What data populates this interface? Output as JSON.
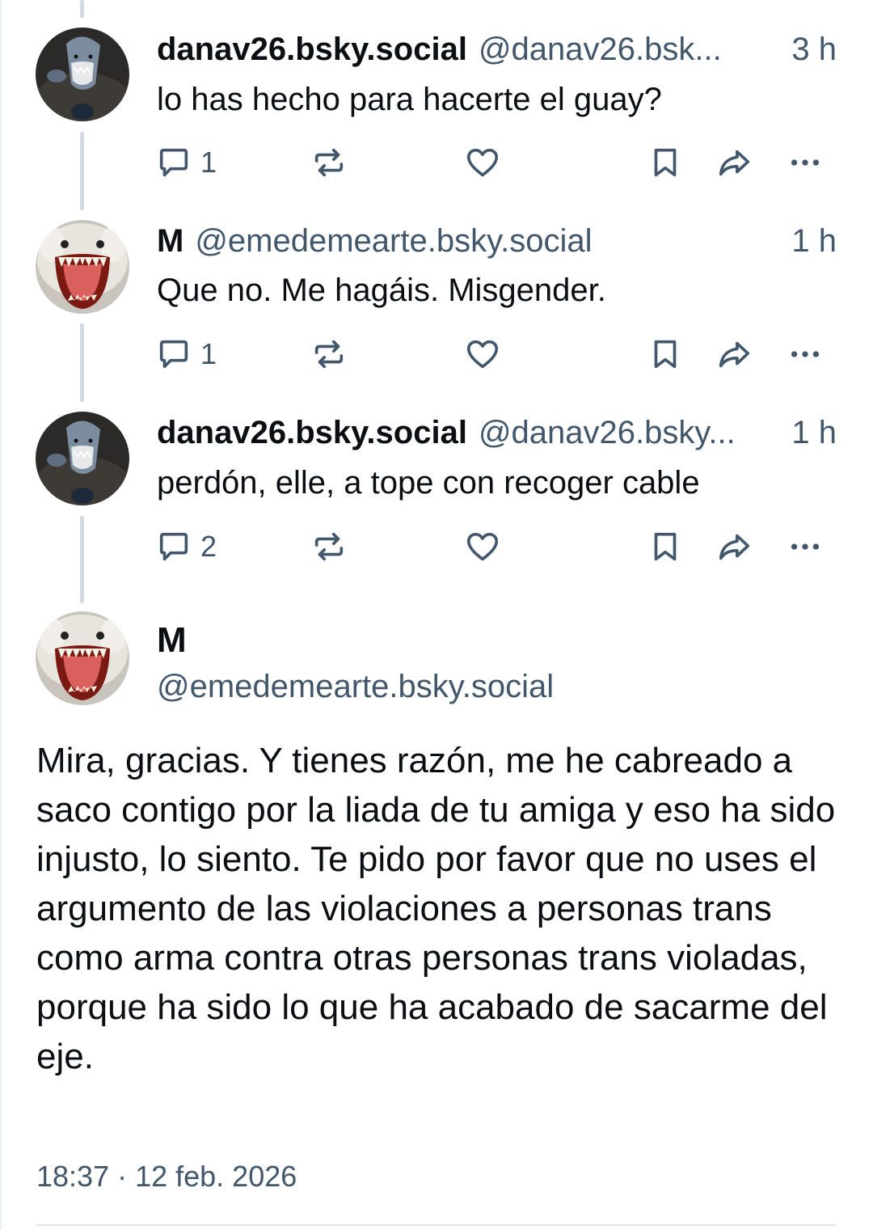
{
  "replies": [
    {
      "display_name": "danav26.bsky.social",
      "handle": "@danav26.bsk...",
      "time": "3 h",
      "text": "lo has hecho para hacerte el guay?",
      "reply_count": "1",
      "avatar": "shark-plush-avatar"
    },
    {
      "display_name": "M",
      "handle": "@emedemearte.bsky.social",
      "time": "1 h",
      "text": "Que no. Me hagáis. Misgender.",
      "reply_count": "1",
      "avatar": "screaming-animal-avatar"
    },
    {
      "display_name": "danav26.bsky.social",
      "handle": "@danav26.bsky...",
      "time": "1 h",
      "text": "perdón, elle, a tope con recoger cable",
      "reply_count": "2",
      "avatar": "shark-plush-avatar"
    }
  ],
  "main_post": {
    "display_name": "M",
    "handle": "@emedemearte.bsky.social",
    "text": "Mira, gracias. Y tienes razón, me he cabreado a saco contigo por la liada de tu amiga y eso ha sido injusto, lo siento. Te pido por favor que no uses el argumento de las violaciones a personas trans como arma contra otras personas trans violadas, porque ha sido lo que ha acabado de sacarme del eje.",
    "timestamp": "18:37 · 12 feb. 2026",
    "avatar": "screaming-animal-avatar"
  },
  "icons": {
    "reply": "speech-bubble-icon",
    "repost": "repost-arrows-icon",
    "like": "heart-icon",
    "bookmark": "bookmark-icon",
    "share": "share-arrow-icon",
    "more": "more-dots-icon"
  },
  "colors": {
    "text": "#0b0f14",
    "muted": "#42576c",
    "thread_line": "#d4dbe2"
  }
}
